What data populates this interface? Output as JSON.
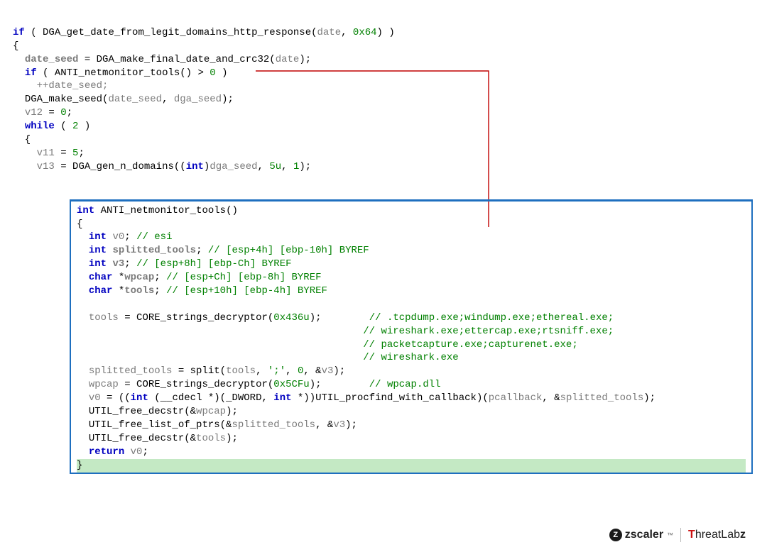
{
  "top_code": {
    "l1": {
      "kw": "if",
      "fn": "DGA_get_date_from_legit_domains_http_response",
      "arg1": "date",
      "arg2": "0x64"
    },
    "l3": {
      "lhs": "date_seed",
      "fn": "DGA_make_final_date_and_crc32",
      "arg": "date"
    },
    "l4": {
      "kw": "if",
      "fn": "ANTI_netmonitor_tools",
      "cmp": "0"
    },
    "l5": {
      "stmt": "++date_seed;"
    },
    "l6": {
      "fn": "DGA_make_seed",
      "arg1": "date_seed",
      "arg2": "dga_seed"
    },
    "l7": {
      "lhs": "v12",
      "rhs": "0"
    },
    "l8": {
      "kw": "while",
      "cond": "2"
    },
    "l10": {
      "lhs": "v11",
      "rhs": "5"
    },
    "l11": {
      "lhs": "v13",
      "fn": "DGA_gen_n_domains",
      "cast": "int",
      "arg1": "dga_seed",
      "arg2": "5u",
      "arg3": "1"
    }
  },
  "box_code": {
    "sig": {
      "ret": "int",
      "name": "ANTI_netmonitor_tools"
    },
    "d1": {
      "type": "int",
      "name": "v0",
      "com": "// esi"
    },
    "d2": {
      "type": "int",
      "name": "splitted_tools",
      "com": "// [esp+4h] [ebp-10h] BYREF"
    },
    "d3": {
      "type": "int",
      "name": "v3",
      "com": "// [esp+8h] [ebp-Ch] BYREF"
    },
    "d4": {
      "type": "char",
      "ptr": "*",
      "name": "wpcap",
      "com": "// [esp+Ch] [ebp-8h] BYREF"
    },
    "d5": {
      "type": "char",
      "ptr": "*",
      "name": "tools",
      "com": "// [esp+10h] [ebp-4h] BYREF"
    },
    "a1": {
      "lhs": "tools",
      "fn": "CORE_strings_decryptor",
      "arg": "0x436u",
      "c1": "// .tcpdump.exe;windump.exe;ethereal.exe;",
      "c2": "// wireshark.exe;ettercap.exe;rtsniff.exe;",
      "c3": "// packetcapture.exe;capturenet.exe;",
      "c4": "// wireshark.exe"
    },
    "a2": {
      "lhs": "splitted_tools",
      "fn": "split",
      "args": [
        "tools",
        "';'",
        "0",
        "&v3"
      ]
    },
    "a3": {
      "lhs": "wpcap",
      "fn": "CORE_strings_decryptor",
      "arg": "0x5CFu",
      "com": "// wpcap.dll"
    },
    "a4": {
      "lhs": "v0",
      "cast_pre": "((",
      "castkw": "int",
      "cast_mid": " (__cdecl *)(_DWORD, ",
      "castkw2": "int",
      "cast_post": " *))",
      "fn": "UTIL_procfind_with_callback",
      "args": [
        "pcallback",
        "&splitted_tools"
      ]
    },
    "a5": {
      "fn": "UTIL_free_decstr",
      "arg": "&wpcap"
    },
    "a6": {
      "fn": "UTIL_free_list_of_ptrs",
      "args": [
        "&splitted_tools",
        "&v3"
      ]
    },
    "a7": {
      "fn": "UTIL_free_decstr",
      "arg": "&tools"
    },
    "ret": {
      "kw": "return",
      "val": "v0"
    }
  },
  "footer": {
    "brand1": "zscaler",
    "brand2_t": "T",
    "brand2_rest": "hreat",
    "brand2_l": "Lab",
    "brand2_z": "z"
  }
}
